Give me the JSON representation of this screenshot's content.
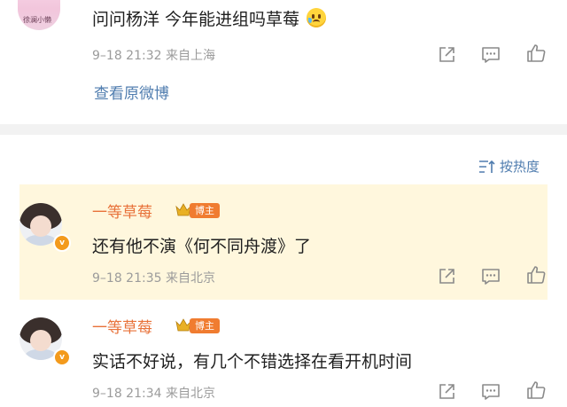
{
  "top_comment": {
    "avatar_text": "徐澜小懒",
    "text": "问问杨洋 今年能进组吗草莓",
    "emoji_icon": "crying-face-emoji",
    "meta": "9–18 21:32  来自上海",
    "view_original": "查看原微博"
  },
  "sort": {
    "label": "按热度"
  },
  "replies": [
    {
      "username": "一等草莓",
      "badge": "博主",
      "text": "还有他不演《何不同舟渡》了",
      "meta": "9–18 21:35  来自北京",
      "verified_mark": "v"
    },
    {
      "username": "一等草莓",
      "badge": "博主",
      "text": "实话不好说，有几个不错选择在看开机时间",
      "meta": "9–18 21:34  来自北京",
      "verified_mark": "v"
    }
  ],
  "colors": {
    "link": "#507daf",
    "username": "#e8723a",
    "highlight_bg": "#fff7dd",
    "divider": "#f2f2f2",
    "meta": "#9b9b9b"
  }
}
